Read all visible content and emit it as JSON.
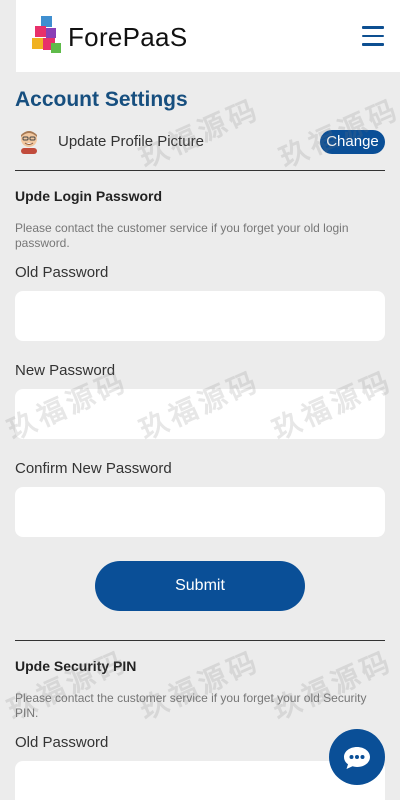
{
  "header": {
    "brand": "ForePaaS",
    "logo_icon": "forepaas-cube-logo",
    "menu_icon": "hamburger-menu-icon"
  },
  "page": {
    "title": "Account Settings"
  },
  "profile": {
    "avatar_icon": "avatar-icon",
    "label": "Update Profile Picture",
    "change_button": "Change"
  },
  "login_password": {
    "title": "Upde Login Password",
    "note": "Please contact the customer service if you forget your old login password.",
    "old_label": "Old Password",
    "old_value": "",
    "new_label": "New Password",
    "new_value": "",
    "confirm_label": "Confirm New Password",
    "confirm_value": "",
    "submit": "Submit"
  },
  "security_pin": {
    "title": "Upde Security PIN",
    "note": "Please contact the customer service if you forget your old Security PIN.",
    "old_label": "Old Password",
    "old_value": ""
  },
  "chat": {
    "icon": "chat-bubble-icon"
  },
  "watermark": "玖福源码",
  "colors": {
    "accent": "#0a4f97",
    "title": "#174f7f",
    "background": "#ececec",
    "menu": "#0d4f91"
  }
}
